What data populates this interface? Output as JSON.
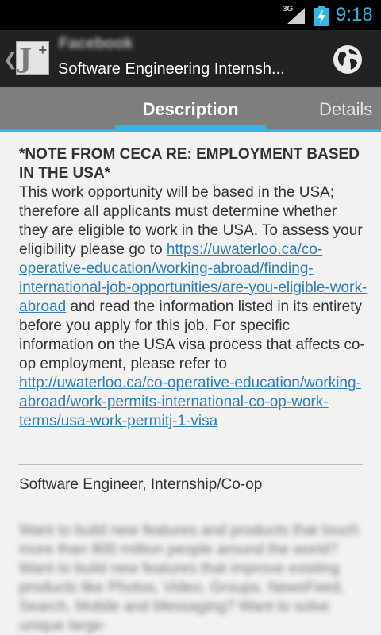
{
  "status_bar": {
    "network": "3G",
    "time": "9:18"
  },
  "action_bar": {
    "company": "Facebook",
    "title": "Software Engineering Internsh...",
    "app_icon_letter": "J",
    "app_icon_plus": "+"
  },
  "tabs": [
    {
      "label": "Description"
    },
    {
      "label": "Details"
    }
  ],
  "content": {
    "note_title": "*NOTE FROM CECA RE: EMPLOYMENT BASED IN THE USA*",
    "para_1": "This work opportunity will be based in the USA; therefore all applicants must determine whether they are eligible to work in the USA. To assess your eligibility please go to ",
    "link_1": "https://uwaterloo.ca/co-operative-education/working-abroad/finding-international-job-opportunities/are-you-eligible-work-abroad",
    "para_2": " and read the information listed in its entirety before you apply for this job. For specific information on the USA visa process that affects co-op employment, please refer to ",
    "link_2": "http://uwaterloo.ca/co-operative-education/working-abroad/work-permits-international-co-op-work-terms/usa-work-permitj-1-visa",
    "position": "Software Engineer, Internship/Co-op",
    "blurred_text": "Want to build new features and products that touch more than 900 million people around the world? Want to build new features that improve existing products like Photos, Video, Groups, NewsFeed, Search, Mobile and Messaging? Want to solve unique large-"
  },
  "colors": {
    "accent": "#33b5e5",
    "link": "#2f7fb4",
    "action_bar_bg": "#222222",
    "tab_bar_bg": "#7e7e7e",
    "content_bg": "#f2f2f2"
  }
}
